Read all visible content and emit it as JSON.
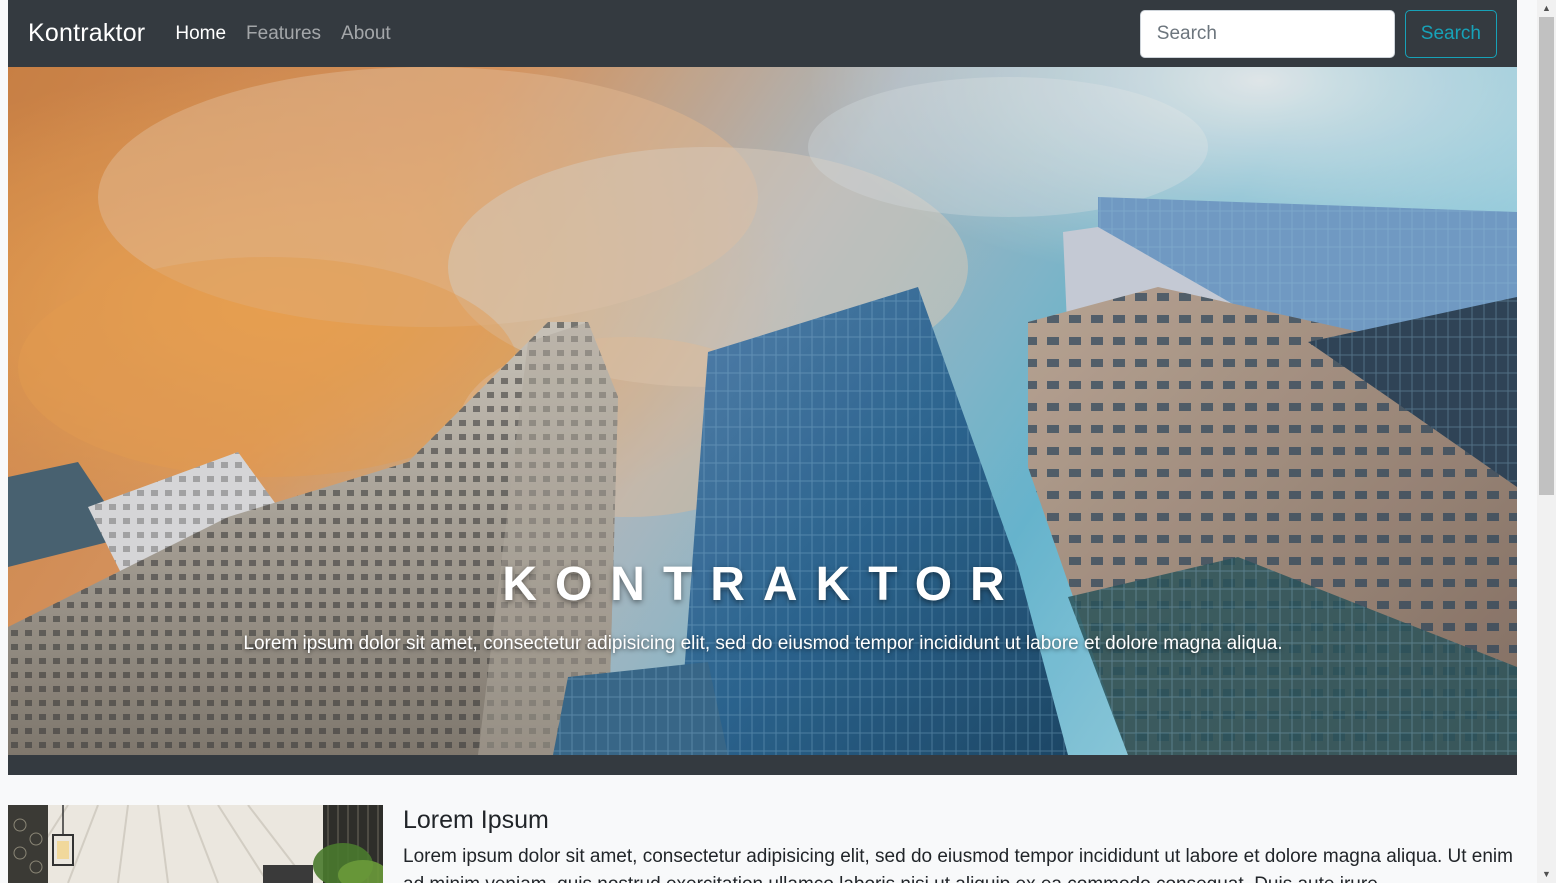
{
  "navbar": {
    "brand": "Kontraktor",
    "links": [
      {
        "label": "Home",
        "active": true
      },
      {
        "label": "Features",
        "active": false
      },
      {
        "label": "About",
        "active": false
      }
    ],
    "search_placeholder": "Search",
    "search_button": "Search"
  },
  "hero": {
    "title": "KONTRAKTOR",
    "subtitle": "Lorem ipsum dolor sit amet, consectetur adipisicing elit, sed do eiusmod tempor incididunt ut labore et dolore magna aliqua."
  },
  "content": {
    "title": "Lorem Ipsum",
    "text": "Lorem ipsum dolor sit amet, consectetur adipisicing elit, sed do eiusmod tempor incididunt ut labore et dolore magna aliqua. Ut enim ad minim veniam, quis nostrud exercitation ullamco laboris nisi ut aliquip ex ea commodo consequat. Duis aute irure"
  },
  "colors": {
    "navbar_bg": "#343a40",
    "accent": "#17a2b8",
    "page_bg": "#f8f9fa"
  },
  "icons": {
    "scroll_up": "chevron-up-icon",
    "scroll_down": "chevron-down-icon"
  }
}
